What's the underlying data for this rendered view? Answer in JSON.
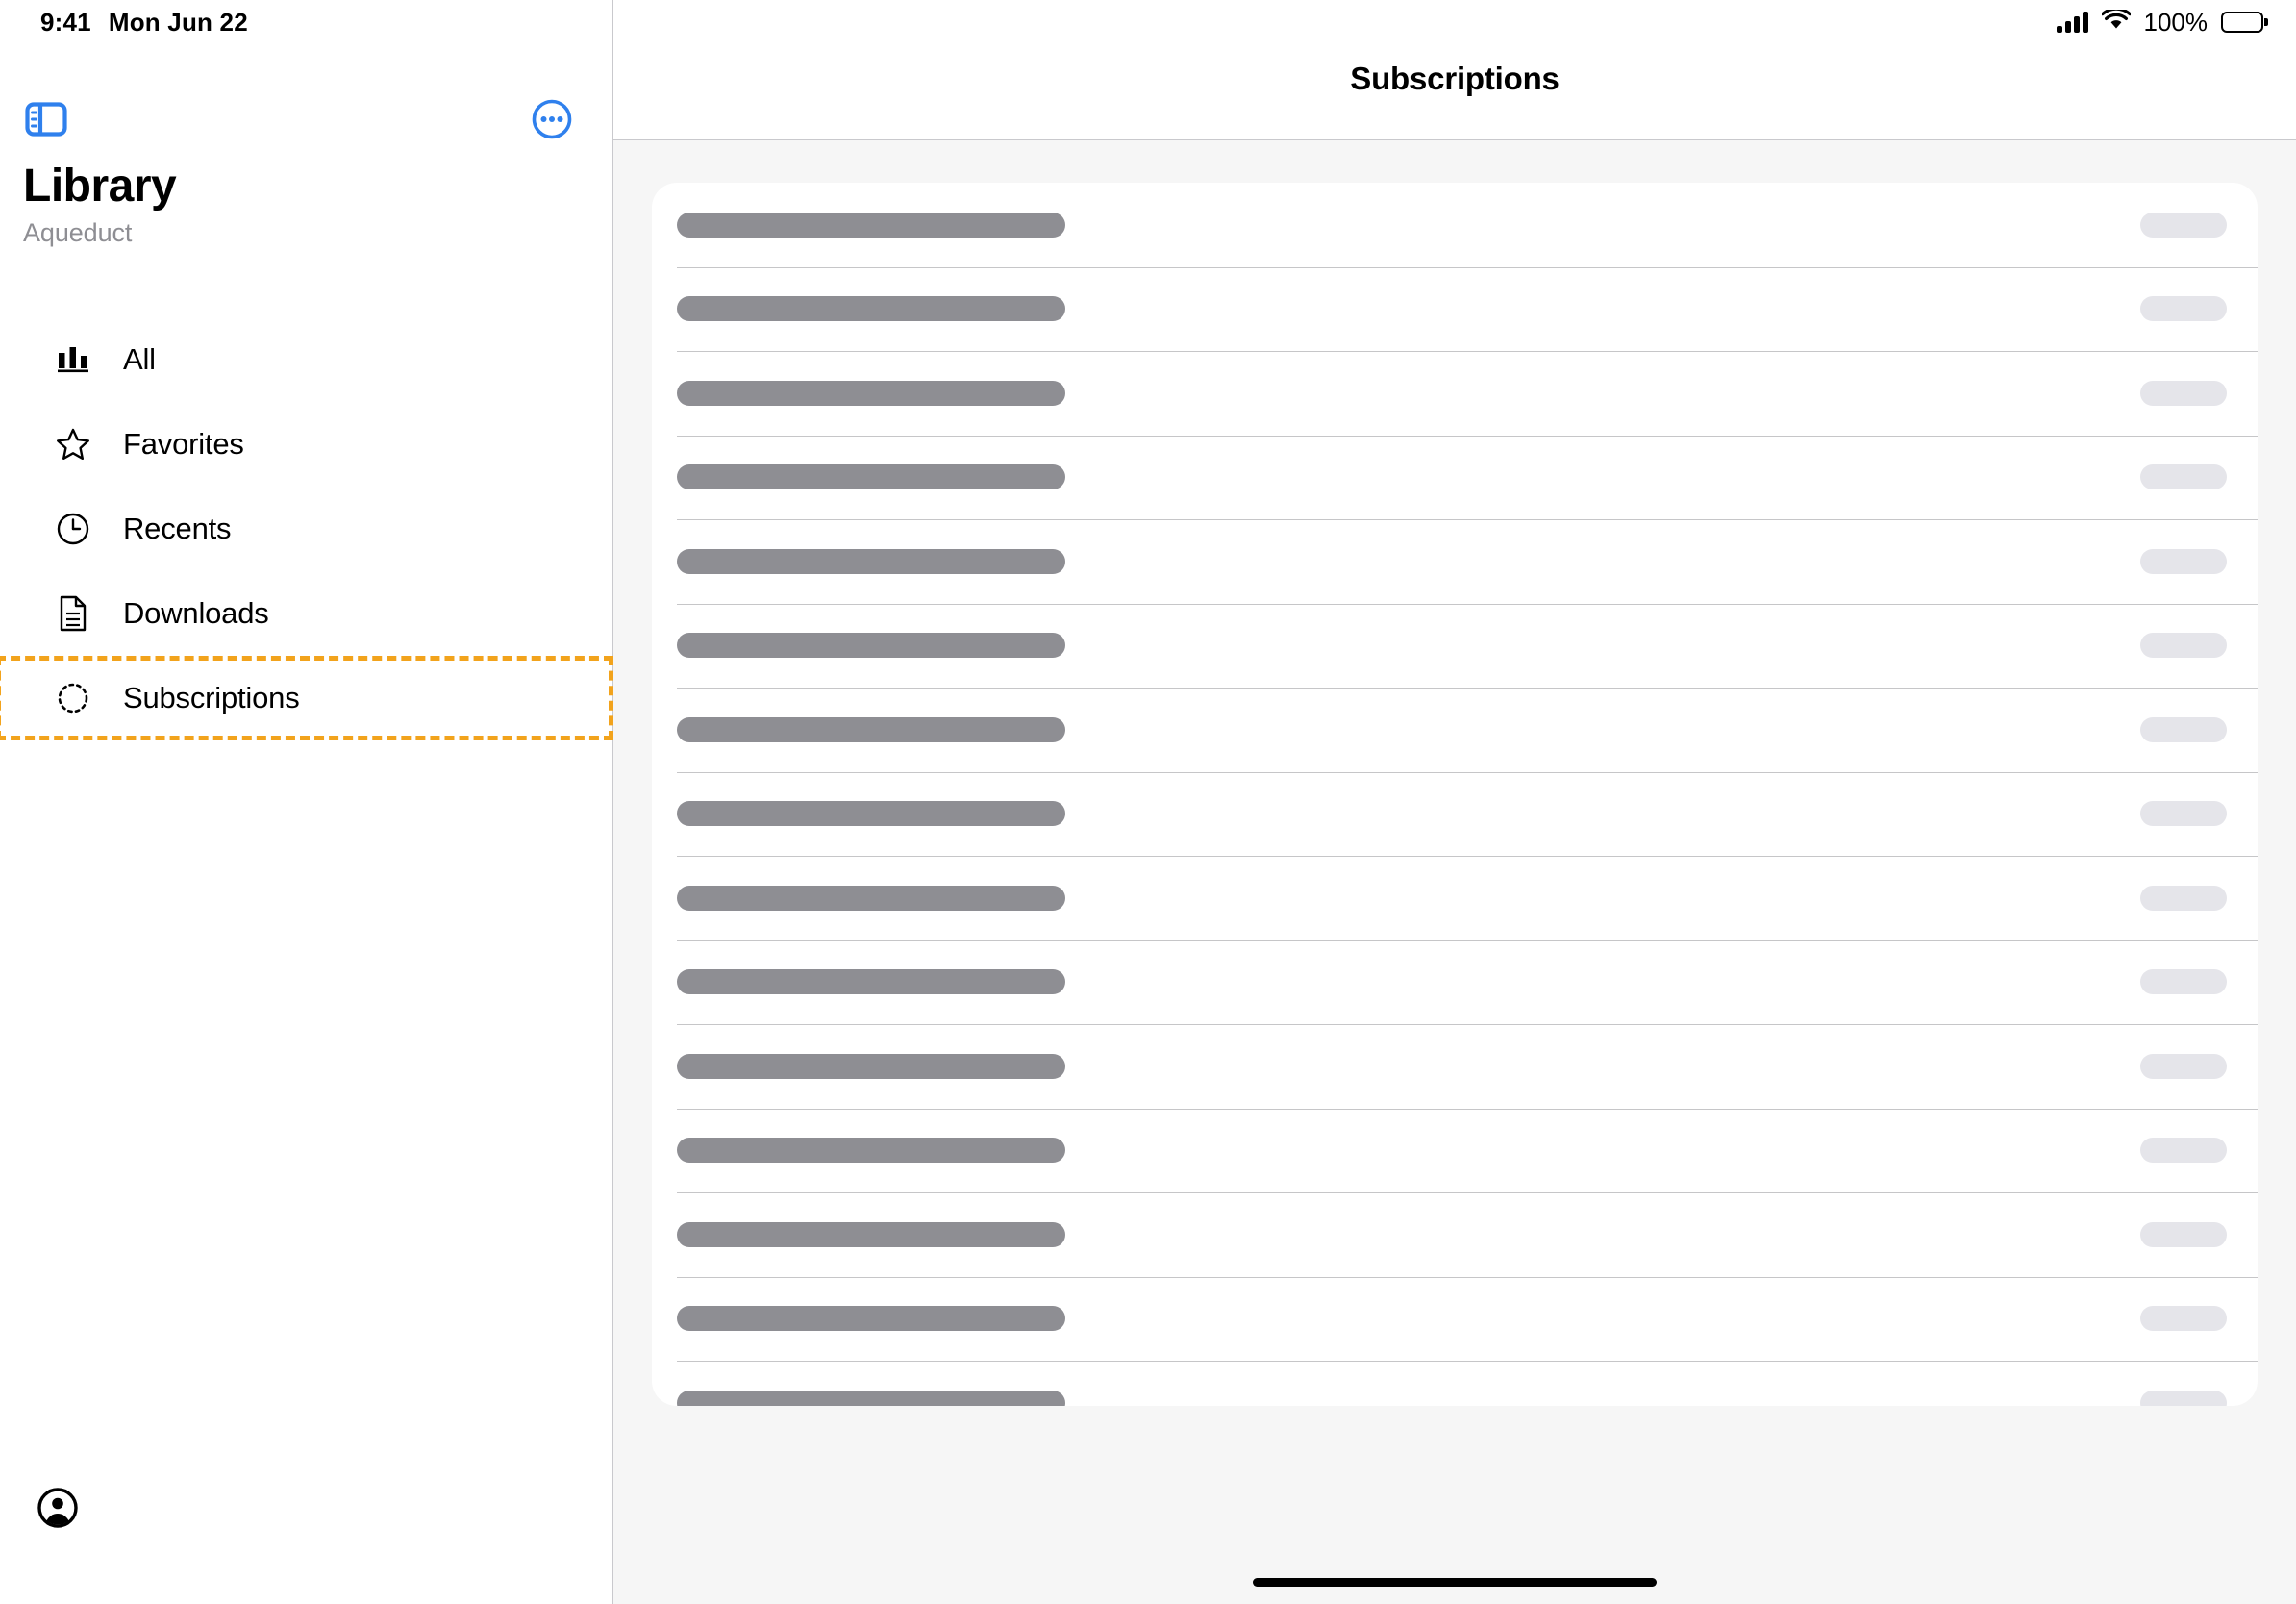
{
  "status_bar": {
    "time": "9:41",
    "date": "Mon Jun 22",
    "battery_percent": "100%",
    "signal_icon": "cellular-bars-icon",
    "wifi_icon": "wifi-icon",
    "battery_icon": "battery-full-icon"
  },
  "sidebar": {
    "toggle_icon": "sidebar-toggle-icon",
    "more_icon": "ellipsis-circle-icon",
    "title": "Library",
    "subtitle": "Aqueduct",
    "account_icon": "account-circle-icon",
    "items": [
      {
        "label": "All",
        "icon": "bar-chart-icon",
        "selected": false
      },
      {
        "label": "Favorites",
        "icon": "star-icon",
        "selected": false
      },
      {
        "label": "Recents",
        "icon": "clock-icon",
        "selected": false
      },
      {
        "label": "Downloads",
        "icon": "document-icon",
        "selected": false
      },
      {
        "label": "Subscriptions",
        "icon": "dashed-circle-icon",
        "selected": true
      }
    ]
  },
  "main": {
    "title": "Subscriptions",
    "rows": [
      {
        "primary_width": 404,
        "secondary_width": 90
      },
      {
        "primary_width": 404,
        "secondary_width": 90
      },
      {
        "primary_width": 404,
        "secondary_width": 90
      },
      {
        "primary_width": 404,
        "secondary_width": 90
      },
      {
        "primary_width": 404,
        "secondary_width": 90
      },
      {
        "primary_width": 404,
        "secondary_width": 90
      },
      {
        "primary_width": 404,
        "secondary_width": 90
      },
      {
        "primary_width": 404,
        "secondary_width": 90
      },
      {
        "primary_width": 404,
        "secondary_width": 90
      },
      {
        "primary_width": 404,
        "secondary_width": 90
      },
      {
        "primary_width": 404,
        "secondary_width": 90
      },
      {
        "primary_width": 404,
        "secondary_width": 90
      },
      {
        "primary_width": 404,
        "secondary_width": 90
      },
      {
        "primary_width": 404,
        "secondary_width": 90
      },
      {
        "primary_width": 404,
        "secondary_width": 90
      }
    ]
  },
  "colors": {
    "accent": "#2f80ed",
    "highlight": "#f2a31c",
    "placeholder_primary": "#8e8e93",
    "placeholder_secondary": "#e5e5ea",
    "page_background": "#f6f6f6",
    "separator": "#c6c6c8"
  }
}
